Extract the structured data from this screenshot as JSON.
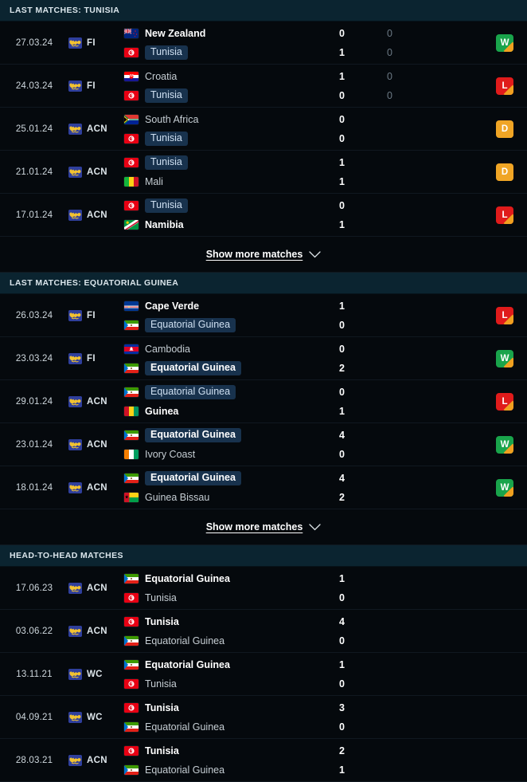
{
  "sections": [
    {
      "id": "last-matches-tunisia",
      "title": "LAST MATCHES: TUNISIA",
      "show_more_label": "Show more matches",
      "matches": [
        {
          "date": "27.03.24",
          "competition": "FI",
          "home": {
            "team": "New Zealand",
            "flag": "new-zealand",
            "score": "0",
            "score2": "0",
            "winner": true,
            "focus": false
          },
          "away": {
            "team": "Tunisia",
            "flag": "tunisia",
            "score": "1",
            "score2": "0",
            "winner": false,
            "focus": true
          },
          "result": "W"
        },
        {
          "date": "24.03.24",
          "competition": "FI",
          "home": {
            "team": "Croatia",
            "flag": "croatia",
            "score": "1",
            "score2": "0",
            "winner": false,
            "focus": false
          },
          "away": {
            "team": "Tunisia",
            "flag": "tunisia",
            "score": "0",
            "score2": "0",
            "winner": false,
            "focus": true
          },
          "result": "L"
        },
        {
          "date": "25.01.24",
          "competition": "ACN",
          "home": {
            "team": "South Africa",
            "flag": "south-africa",
            "score": "0",
            "score2": "",
            "winner": false,
            "focus": false
          },
          "away": {
            "team": "Tunisia",
            "flag": "tunisia",
            "score": "0",
            "score2": "",
            "winner": false,
            "focus": true
          },
          "result": "D"
        },
        {
          "date": "21.01.24",
          "competition": "ACN",
          "home": {
            "team": "Tunisia",
            "flag": "tunisia",
            "score": "1",
            "score2": "",
            "winner": false,
            "focus": true
          },
          "away": {
            "team": "Mali",
            "flag": "mali",
            "score": "1",
            "score2": "",
            "winner": false,
            "focus": false
          },
          "result": "D"
        },
        {
          "date": "17.01.24",
          "competition": "ACN",
          "home": {
            "team": "Tunisia",
            "flag": "tunisia",
            "score": "0",
            "score2": "",
            "winner": false,
            "focus": true
          },
          "away": {
            "team": "Namibia",
            "flag": "namibia",
            "score": "1",
            "score2": "",
            "winner": true,
            "focus": false
          },
          "result": "L"
        }
      ]
    },
    {
      "id": "last-matches-equatorial-guinea",
      "title": "LAST MATCHES: EQUATORIAL GUINEA",
      "show_more_label": "Show more matches",
      "matches": [
        {
          "date": "26.03.24",
          "competition": "FI",
          "home": {
            "team": "Cape Verde",
            "flag": "cape-verde",
            "score": "1",
            "score2": "",
            "winner": true,
            "focus": false
          },
          "away": {
            "team": "Equatorial Guinea",
            "flag": "equatorial-guinea",
            "score": "0",
            "score2": "",
            "winner": false,
            "focus": true
          },
          "result": "L"
        },
        {
          "date": "23.03.24",
          "competition": "FI",
          "home": {
            "team": "Cambodia",
            "flag": "cambodia",
            "score": "0",
            "score2": "",
            "winner": false,
            "focus": false
          },
          "away": {
            "team": "Equatorial Guinea",
            "flag": "equatorial-guinea",
            "score": "2",
            "score2": "",
            "winner": true,
            "focus": true
          },
          "result": "W"
        },
        {
          "date": "29.01.24",
          "competition": "ACN",
          "home": {
            "team": "Equatorial Guinea",
            "flag": "equatorial-guinea",
            "score": "0",
            "score2": "",
            "winner": false,
            "focus": true
          },
          "away": {
            "team": "Guinea",
            "flag": "guinea",
            "score": "1",
            "score2": "",
            "winner": true,
            "focus": false
          },
          "result": "L"
        },
        {
          "date": "23.01.24",
          "competition": "ACN",
          "home": {
            "team": "Equatorial Guinea",
            "flag": "equatorial-guinea",
            "score": "4",
            "score2": "",
            "winner": true,
            "focus": true
          },
          "away": {
            "team": "Ivory Coast",
            "flag": "ivory-coast",
            "score": "0",
            "score2": "",
            "winner": false,
            "focus": false
          },
          "result": "W"
        },
        {
          "date": "18.01.24",
          "competition": "ACN",
          "home": {
            "team": "Equatorial Guinea",
            "flag": "equatorial-guinea",
            "score": "4",
            "score2": "",
            "winner": true,
            "focus": true
          },
          "away": {
            "team": "Guinea Bissau",
            "flag": "guinea-bissau",
            "score": "2",
            "score2": "",
            "winner": false,
            "focus": false
          },
          "result": "W"
        }
      ]
    },
    {
      "id": "head-to-head-matches",
      "title": "HEAD-TO-HEAD MATCHES",
      "show_more_label": "",
      "matches": [
        {
          "date": "17.06.23",
          "competition": "ACN",
          "home": {
            "team": "Equatorial Guinea",
            "flag": "equatorial-guinea",
            "score": "1",
            "score2": "",
            "winner": true,
            "focus": false
          },
          "away": {
            "team": "Tunisia",
            "flag": "tunisia",
            "score": "0",
            "score2": "",
            "winner": false,
            "focus": false
          },
          "result": ""
        },
        {
          "date": "03.06.22",
          "competition": "ACN",
          "home": {
            "team": "Tunisia",
            "flag": "tunisia",
            "score": "4",
            "score2": "",
            "winner": true,
            "focus": false
          },
          "away": {
            "team": "Equatorial Guinea",
            "flag": "equatorial-guinea",
            "score": "0",
            "score2": "",
            "winner": false,
            "focus": false
          },
          "result": ""
        },
        {
          "date": "13.11.21",
          "competition": "WC",
          "home": {
            "team": "Equatorial Guinea",
            "flag": "equatorial-guinea",
            "score": "1",
            "score2": "",
            "winner": true,
            "focus": false
          },
          "away": {
            "team": "Tunisia",
            "flag": "tunisia",
            "score": "0",
            "score2": "",
            "winner": false,
            "focus": false
          },
          "result": ""
        },
        {
          "date": "04.09.21",
          "competition": "WC",
          "home": {
            "team": "Tunisia",
            "flag": "tunisia",
            "score": "3",
            "score2": "",
            "winner": true,
            "focus": false
          },
          "away": {
            "team": "Equatorial Guinea",
            "flag": "equatorial-guinea",
            "score": "0",
            "score2": "",
            "winner": false,
            "focus": false
          },
          "result": ""
        },
        {
          "date": "28.03.21",
          "competition": "ACN",
          "home": {
            "team": "Tunisia",
            "flag": "tunisia",
            "score": "2",
            "score2": "",
            "winner": true,
            "focus": false
          },
          "away": {
            "team": "Equatorial Guinea",
            "flag": "equatorial-guinea",
            "score": "1",
            "score2": "",
            "winner": false,
            "focus": false
          },
          "result": ""
        }
      ]
    }
  ],
  "icons": {
    "competition": "globe-icon",
    "chevron": "chevron-down-icon"
  },
  "colors": {
    "background": "#05090d",
    "header_background": "#0b2430",
    "win": "#19a44b",
    "loss": "#e01b1b",
    "draw": "#f0a525",
    "focus_highlight": "#18324d"
  }
}
